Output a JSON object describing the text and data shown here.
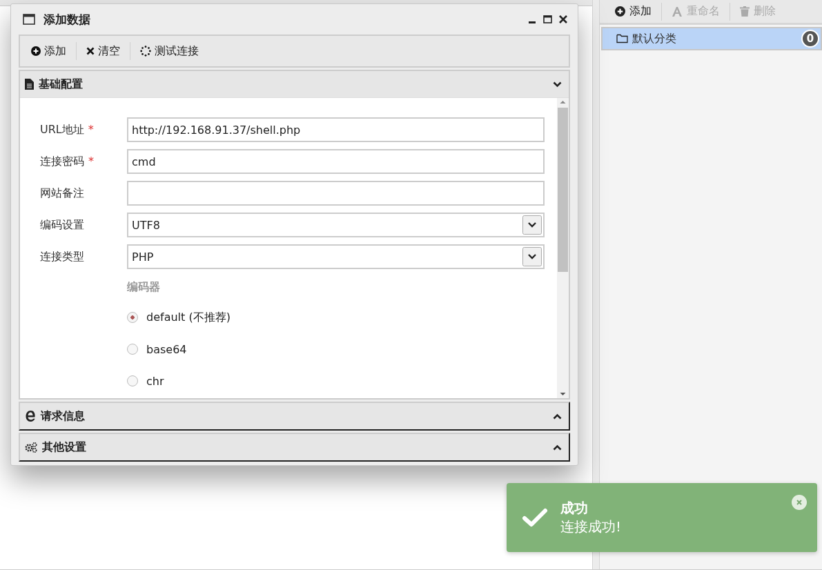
{
  "sidebar": {
    "toolbar": [
      {
        "label": "添加",
        "disabled": false
      },
      {
        "label": "重命名",
        "disabled": true
      },
      {
        "label": "删除",
        "disabled": true
      }
    ],
    "items": [
      {
        "label": "默认分类",
        "count": "0",
        "selected": true
      }
    ]
  },
  "dialog": {
    "title": "添加数据",
    "toolbar": [
      {
        "label": "添加"
      },
      {
        "label": "清空"
      },
      {
        "label": "测试连接"
      }
    ],
    "sections": [
      {
        "title": "基础配置",
        "expanded": true
      },
      {
        "title": "请求信息",
        "expanded": false
      },
      {
        "title": "其他设置",
        "expanded": false
      }
    ],
    "fields": [
      {
        "label": "URL地址",
        "required_mark": "*",
        "kind": "text",
        "value": "http://192.168.91.37/shell.php"
      },
      {
        "label": "连接密码",
        "required_mark": "*",
        "kind": "text",
        "value": "cmd"
      },
      {
        "label": "网站备注",
        "kind": "text"
      },
      {
        "label": "编码设置",
        "kind": "select",
        "value": "UTF8"
      },
      {
        "label": "连接类型",
        "kind": "select",
        "value": "PHP"
      }
    ],
    "encoder": {
      "label": "编码器",
      "options": [
        {
          "label": "default (不推荐)",
          "selected": true
        },
        {
          "label": "base64",
          "selected": false
        },
        {
          "label": "chr",
          "selected": false
        }
      ]
    }
  },
  "toast": {
    "title": "成功",
    "message": "连接成功!"
  }
}
